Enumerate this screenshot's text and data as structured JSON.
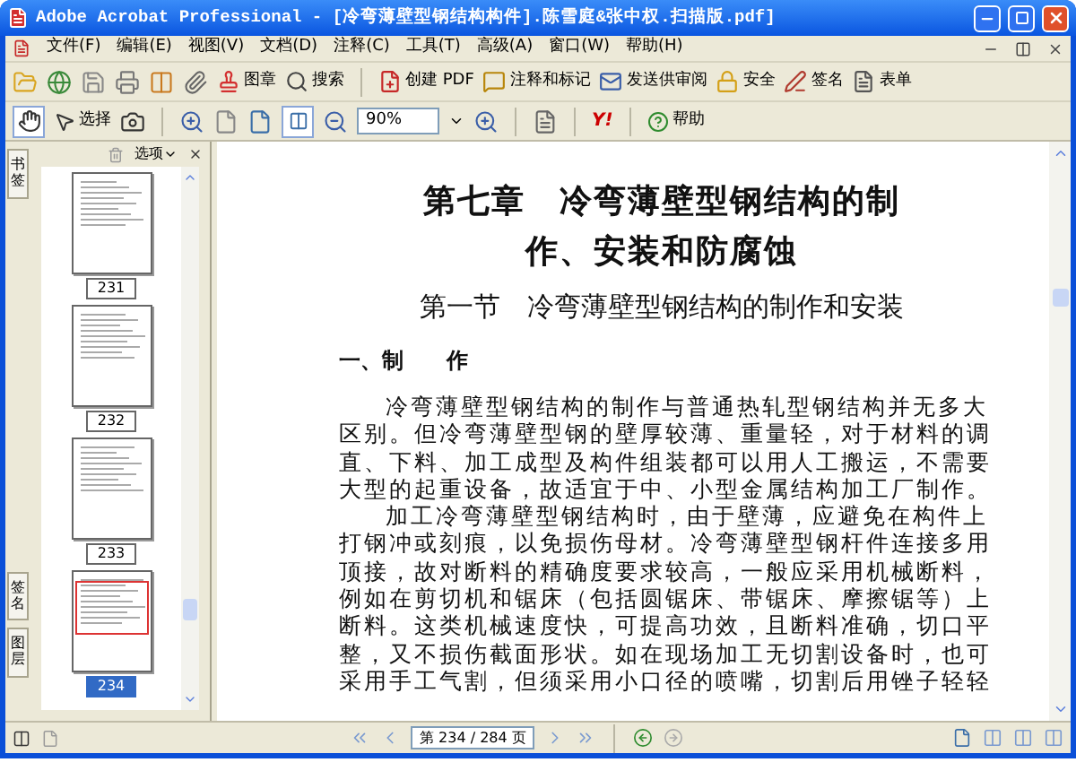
{
  "window": {
    "title": "Adobe Acrobat Professional - [冷弯薄壁型钢结构构件].陈雪庭&张中权.扫描版.pdf]"
  },
  "menu": [
    "文件(F)",
    "编辑(E)",
    "视图(V)",
    "文档(D)",
    "注释(C)",
    "工具(T)",
    "高级(A)",
    "窗口(W)",
    "帮助(H)"
  ],
  "toolbar_1": [
    "图章",
    "搜索",
    "创建 PDF",
    "注释和标记",
    "发送供审阅",
    "安全",
    "签名",
    "表单"
  ],
  "toolbar_2": {
    "select": "选择",
    "zoom": "90%",
    "yahoo": "Y!",
    "help": "帮助"
  },
  "sidebar": {
    "options": "选项",
    "tabs": [
      "书签",
      "签名",
      "图层"
    ],
    "thumbnails": [
      {
        "label": "231",
        "selected": false
      },
      {
        "label": "232",
        "selected": false
      },
      {
        "label": "233",
        "selected": false
      },
      {
        "label": "234",
        "selected": true
      }
    ]
  },
  "page": {
    "chapter_title": [
      "第七章　冷弯薄壁型钢结构的制",
      "作、安装和防腐蚀"
    ],
    "section_title": "第一节　冷弯薄壁型钢结构的制作和安装",
    "subsection_title": "一、制　　作",
    "lines": [
      {
        "kind": "first",
        "text": "冷弯薄壁型钢结构的制作与普通热轧型钢结构并无多大"
      },
      {
        "kind": "cont",
        "text": "区别。但冷弯薄壁型钢的壁厚较薄、重量轻，对于材料的调"
      },
      {
        "kind": "cont",
        "text": "直、下料、加工成型及构件组装都可以用人工搬运，不需要"
      },
      {
        "kind": "cont",
        "text": "大型的起重设备，故适宜于中、小型金属结构加工厂制作。"
      },
      {
        "kind": "first",
        "text": "加工冷弯薄壁型钢结构时，由于壁薄，应避免在构件上"
      },
      {
        "kind": "cont",
        "text": "打钢冲或刻痕，以免损伤母材。冷弯薄壁型钢杆件连接多用"
      },
      {
        "kind": "cont",
        "text": "顶接，故对断料的精确度要求较高，一般应采用机械断料，"
      },
      {
        "kind": "cont",
        "text": "例如在剪切机和锯床（包括圆锯床、带锯床、摩擦锯等）上"
      },
      {
        "kind": "cont",
        "text": "断料。这类机械速度快，可提高功效，且断料准确，切口平"
      },
      {
        "kind": "cont",
        "text": "整，又不损伤截面形状。如在现场加工无切割设备时，也可"
      },
      {
        "kind": "cont",
        "text": "采用手工气割，但须采用小口径的喷嘴，切割后用锉子轻轻"
      }
    ]
  },
  "navigation": {
    "page_field": "第 234 / 284 页"
  }
}
